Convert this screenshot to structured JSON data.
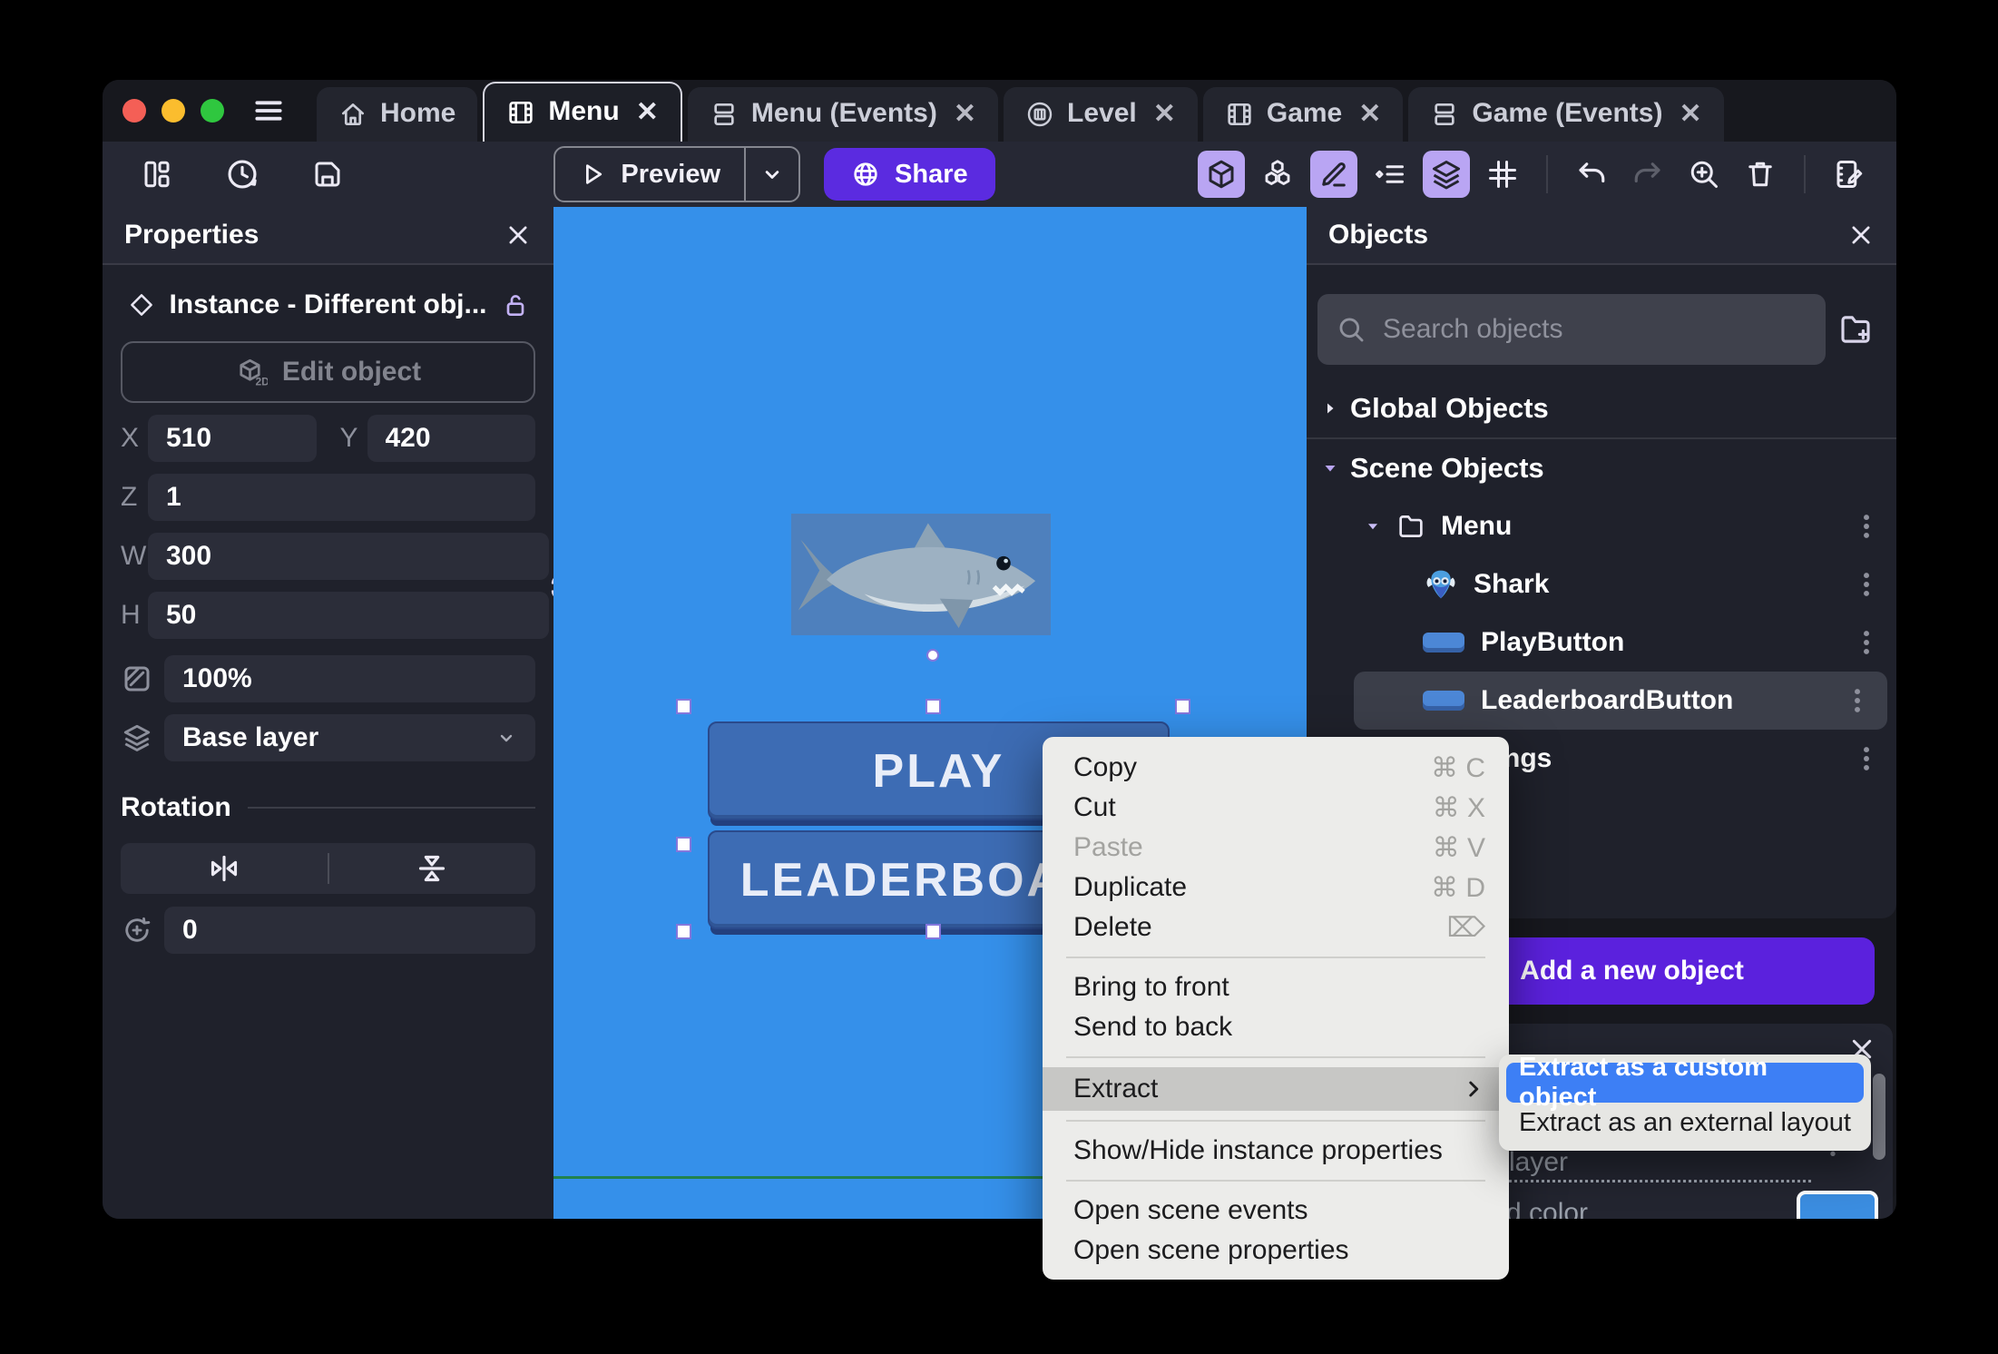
{
  "tabs": [
    {
      "label": "Home",
      "icon": "home-icon",
      "closable": false,
      "active": false
    },
    {
      "label": "Menu",
      "icon": "scene-film-icon",
      "closable": true,
      "active": true
    },
    {
      "label": "Menu (Events)",
      "icon": "events-sheet-icon",
      "closable": true,
      "active": false
    },
    {
      "label": "Level",
      "icon": "external-level-icon",
      "closable": true,
      "active": false
    },
    {
      "label": "Game",
      "icon": "scene-film-icon",
      "closable": true,
      "active": false
    },
    {
      "label": "Game (Events)",
      "icon": "events-sheet-icon",
      "closable": true,
      "active": false
    }
  ],
  "toolbar": {
    "preview_label": "Preview",
    "share_label": "Share",
    "left_icons": [
      "open-panels-icon",
      "history-icon",
      "save-icon"
    ],
    "right_icons": [
      "cube-3d-icon",
      "instances-cubes-icon",
      "pencil-edit-icon",
      "instance-list-icon",
      "layers-icon",
      "grid-icon",
      "undo-icon",
      "redo-icon",
      "zoom-in-icon",
      "trash-icon",
      "scene-notes-icon"
    ]
  },
  "properties": {
    "title": "Properties",
    "instance_label": "Instance  -  Different obj...",
    "edit_object_label": "Edit object",
    "fields": {
      "x": {
        "label": "X",
        "value": "510"
      },
      "y": {
        "label": "Y",
        "value": "420"
      },
      "z": {
        "label": "Z",
        "value": "1"
      },
      "w": {
        "label": "W",
        "value": "300"
      },
      "h": {
        "label": "H",
        "value": "50"
      },
      "opacity": {
        "value": "100%"
      },
      "layer": {
        "value": "Base layer"
      },
      "angle": {
        "value": "0"
      }
    },
    "rotation_section_label": "Rotation"
  },
  "canvas": {
    "background_color": "#3590ea",
    "play_button_label": "PLAY",
    "leaderboard_button_label": "LEADERBOARD"
  },
  "objects_panel": {
    "title": "Objects",
    "search_placeholder": "Search objects",
    "global_section_label": "Global Objects",
    "scene_section_label": "Scene Objects",
    "tree": [
      {
        "label": "Menu",
        "type": "folder",
        "expanded": true
      },
      {
        "label": "Shark",
        "type": "sprite",
        "icon": "shark-icon"
      },
      {
        "label": "PlayButton",
        "type": "button-object"
      },
      {
        "label": "LeaderboardButton",
        "type": "button-object",
        "selected": true
      },
      {
        "label": "Settings",
        "type": "folder",
        "expanded": false
      }
    ],
    "add_button_label": "Add a new object",
    "layer_panel": {
      "partial_text_top": "layer",
      "partial_text_bottom": "d color",
      "swatch_color": "#3b8de0"
    }
  },
  "context_menu": {
    "items": [
      {
        "label": "Copy",
        "shortcut": "⌘ C"
      },
      {
        "label": "Cut",
        "shortcut": "⌘ X"
      },
      {
        "label": "Paste",
        "shortcut": "⌘ V",
        "disabled": true
      },
      {
        "label": "Duplicate",
        "shortcut": "⌘ D"
      },
      {
        "label": "Delete",
        "shortcut": "⌦"
      },
      {
        "label": "Bring to front"
      },
      {
        "label": "Send to back"
      },
      {
        "label": "Extract",
        "has_submenu": true,
        "highlighted": true
      },
      {
        "label": "Show/Hide instance properties"
      },
      {
        "label": "Open scene events"
      },
      {
        "label": "Open scene properties"
      }
    ]
  },
  "submenu": {
    "items": [
      {
        "label": "Extract as a custom object",
        "selected": true
      },
      {
        "label": "Extract as an external layout",
        "selected": false
      }
    ]
  },
  "colors": {
    "accent_purple": "#5b2be0",
    "add_button_purple": "#5b21dd",
    "toggle_lavender": "#b9a5f3",
    "canvas_blue": "#3590ea",
    "scene_button_blue": "#3d6cb4",
    "submenu_selection_blue": "#3d7ff5",
    "swatch_blue": "#3b8de0"
  }
}
